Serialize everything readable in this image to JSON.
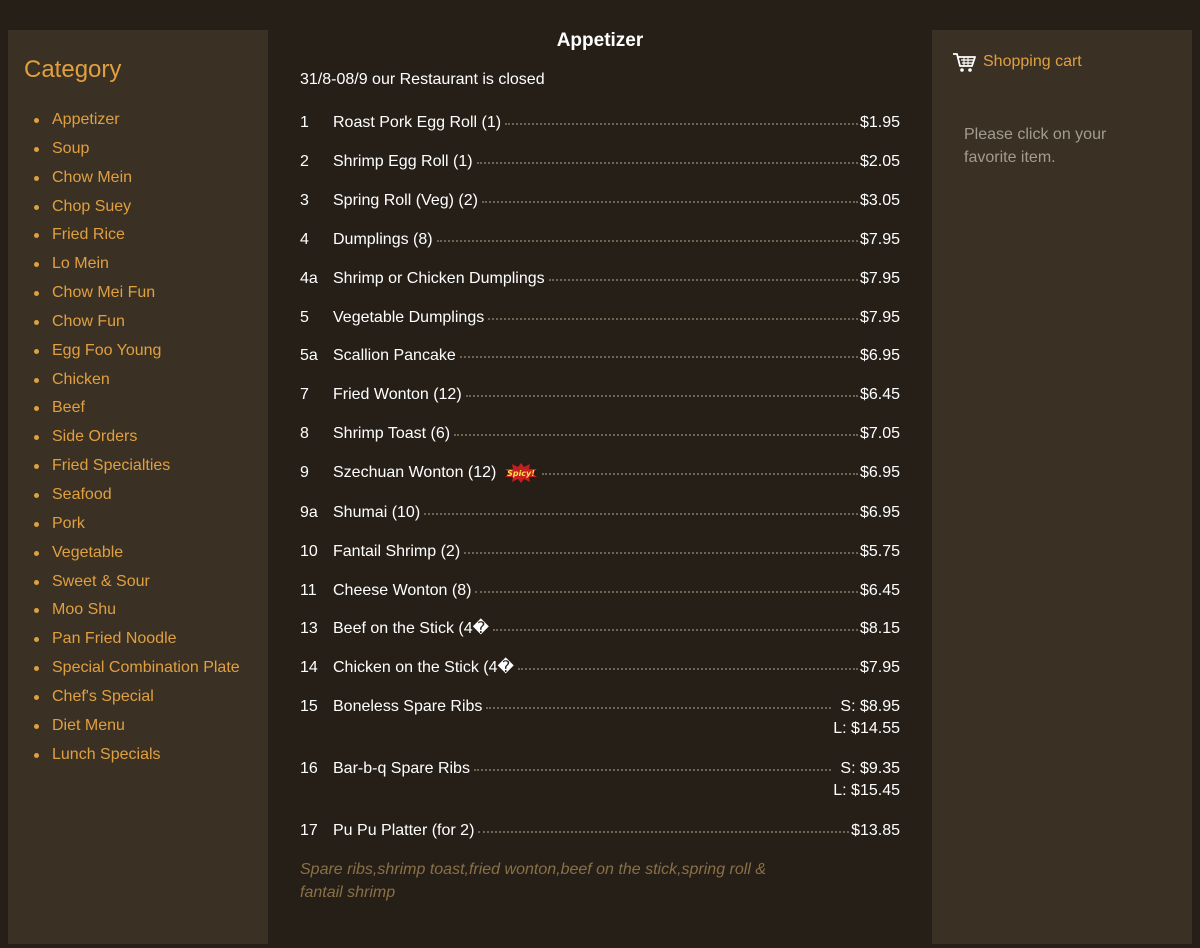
{
  "sidebar": {
    "title": "Category",
    "items": [
      "Appetizer",
      "Soup",
      "Chow Mein",
      "Chop Suey",
      "Fried Rice",
      "Lo Mein",
      "Chow Mei Fun",
      "Chow Fun",
      "Egg Foo Young",
      "Chicken",
      "Beef",
      "Side Orders",
      "Fried Specialties",
      "Seafood",
      "Pork",
      "Vegetable",
      "Sweet & Sour",
      "Moo Shu",
      "Pan Fried Noodle",
      "Special Combination Plate",
      "Chef's Special",
      "Diet Menu",
      "Lunch Specials"
    ]
  },
  "menu": {
    "title": "Appetizer",
    "notice": "31/8-08/9 our Restaurant is closed",
    "items": [
      {
        "num": "1",
        "name": "Roast Pork Egg Roll (1)",
        "price": "$1.95"
      },
      {
        "num": "2",
        "name": "Shrimp Egg Roll (1)",
        "price": "$2.05"
      },
      {
        "num": "3",
        "name": "Spring Roll (Veg) (2)",
        "price": "$3.05"
      },
      {
        "num": "4",
        "name": "Dumplings (8)",
        "price": "$7.95"
      },
      {
        "num": "4a",
        "name": "Shrimp or Chicken Dumplings",
        "price": "$7.95"
      },
      {
        "num": "5",
        "name": "Vegetable Dumplings",
        "price": "$7.95"
      },
      {
        "num": "5a",
        "name": "Scallion Pancake",
        "price": "$6.95"
      },
      {
        "num": "7",
        "name": "Fried Wonton (12)",
        "price": "$6.45"
      },
      {
        "num": "8",
        "name": "Shrimp Toast (6)",
        "price": "$7.05"
      },
      {
        "num": "9",
        "name": "Szechuan Wonton (12)",
        "price": "$6.95",
        "badge": "Spicy!"
      },
      {
        "num": "9a",
        "name": "Shumai (10)",
        "price": "$6.95"
      },
      {
        "num": "10",
        "name": "Fantail Shrimp (2)",
        "price": "$5.75"
      },
      {
        "num": "11",
        "name": "Cheese Wonton (8)",
        "price": "$6.45"
      },
      {
        "num": "13",
        "name": "Beef on the Stick (4�",
        "price": "$8.15"
      },
      {
        "num": "14",
        "name": "Chicken on the Stick (4�",
        "price": "$7.95"
      },
      {
        "num": "15",
        "name": "Boneless Spare Ribs",
        "price_small": "S: $8.95",
        "price_large": "L: $14.55"
      },
      {
        "num": "16",
        "name": "Bar-b-q Spare Ribs",
        "price_small": "S: $9.35",
        "price_large": "L: $15.45"
      },
      {
        "num": "17",
        "name": "Pu Pu Platter (for 2)",
        "price": "$13.85"
      }
    ],
    "last_desc": "Spare ribs,shrimp toast,fried wonton,beef on the stick,spring roll & fantail shrimp"
  },
  "cart": {
    "label": "Shopping cart",
    "icon": "shopping-cart-icon",
    "message": "Please click on your favorite item."
  },
  "colors": {
    "background": "#261f17",
    "panel": "#3a3024",
    "accent": "#e0a040",
    "desc": "#8a7046"
  }
}
